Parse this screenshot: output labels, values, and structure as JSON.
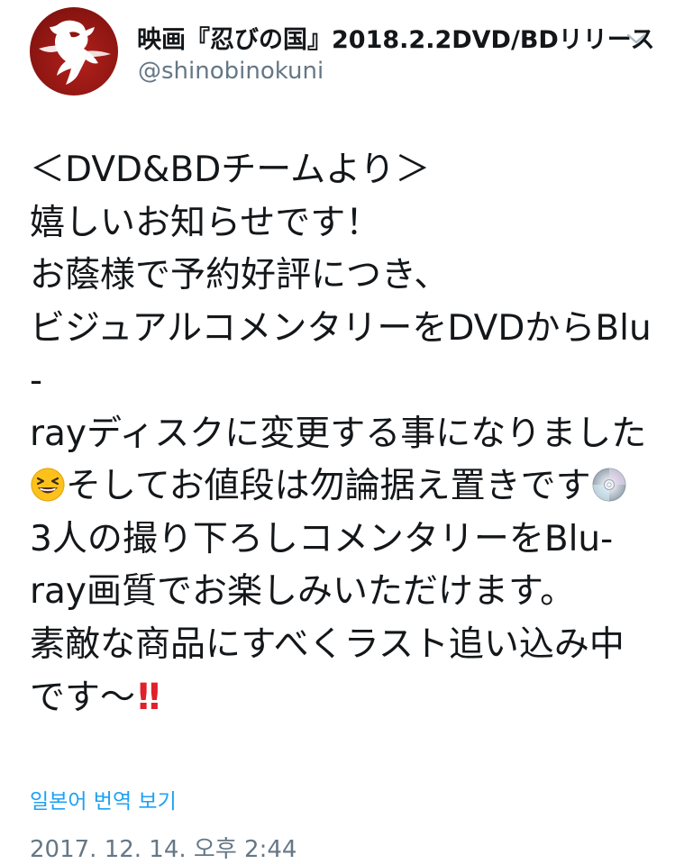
{
  "tweet": {
    "author": {
      "display_name": "映画『忍びの国』2018.2.2DVD/BDリリース",
      "handle": "@shinobinokuni"
    },
    "lines": [
      "＜DVD&BDチームより＞",
      "嬉しいお知らせです！",
      "お蔭様で予約好評につき、",
      "ビジュアルコメンタリーをDVDからBlu",
      "-",
      "rayディスクに変更する事になりました",
      "そしてお値段は勿論据え置きです",
      "3人の撮り下ろしコメンタリーをBlu-",
      "ray画質でお楽しみいただけます。",
      "素敵な商品にすべくラスト追い込み中",
      "です～"
    ],
    "emphasis": "!!",
    "emoji": {
      "laugh": "grinning-squinting-face-emoji",
      "disc": "dvd-disc-emoji"
    },
    "translate_link": "일본어 번역 보기",
    "timestamp": "2017. 12. 14. 오후 2:44"
  },
  "colors": {
    "text": "#14171a",
    "secondary": "#657786",
    "link": "#1da1f2",
    "avatar_bg": "#8e1612",
    "emphasis": "#e0202a"
  },
  "icons": {
    "caret": "chevron-down-icon"
  }
}
